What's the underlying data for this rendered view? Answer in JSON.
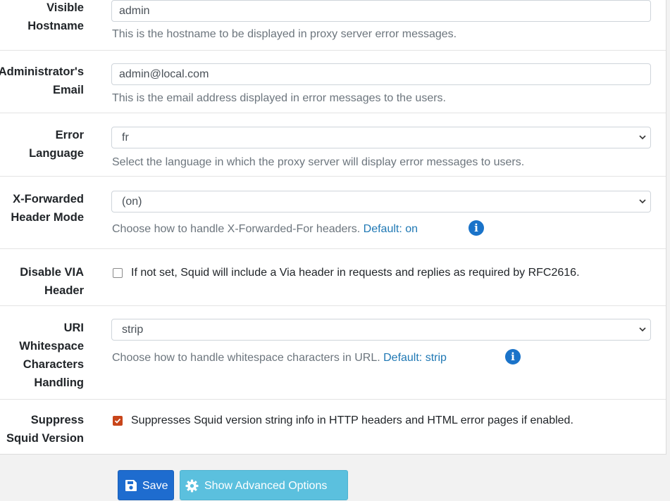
{
  "fields": {
    "visible_hostname": {
      "label_line1": "Visible",
      "label_line2": "Hostname",
      "value": "admin",
      "help": "This is the hostname to be displayed in proxy server error messages."
    },
    "admin_email": {
      "label_line1": "Administrator's",
      "label_line2": "Email",
      "value": "admin@local.com",
      "help": "This is the email address displayed in error messages to the users."
    },
    "error_language": {
      "label_line1": "Error",
      "label_line2": "Language",
      "value": "fr",
      "help": "Select the language in which the proxy server will display error messages to users."
    },
    "x_forwarded": {
      "label_line1": "X-Forwarded",
      "label_line2": "Header Mode",
      "value": "(on)",
      "help": "Choose how to handle X-Forwarded-For headers.",
      "default": "Default: on"
    },
    "disable_via": {
      "label_line1": "Disable VIA",
      "label_line2": "Header",
      "checked": false,
      "text": "If not set, Squid will include a Via header in requests and replies as required by RFC2616."
    },
    "uri_whitespace": {
      "label_line1": "URI",
      "label_line2": "Whitespace",
      "label_line3": "Characters",
      "label_line4": "Handling",
      "value": "strip",
      "help": "Choose how to handle whitespace characters in URL.",
      "default": "Default: strip"
    },
    "suppress_version": {
      "label_line1": "Suppress",
      "label_line2": "Squid Version",
      "checked": true,
      "text": "Suppresses Squid version string info in HTTP headers and HTML error pages if enabled."
    }
  },
  "buttons": {
    "save": "Save",
    "advanced": "Show Advanced Options"
  },
  "icons": {
    "info": "info-icon",
    "chevron": "chevron-down-icon",
    "save": "floppy-disk-icon",
    "advanced": "gear-icon"
  },
  "colors": {
    "primary": "#1e6ccf",
    "info_button": "#5bc0de",
    "checkbox_checked": "#c8451a",
    "link": "#1f78b4"
  }
}
